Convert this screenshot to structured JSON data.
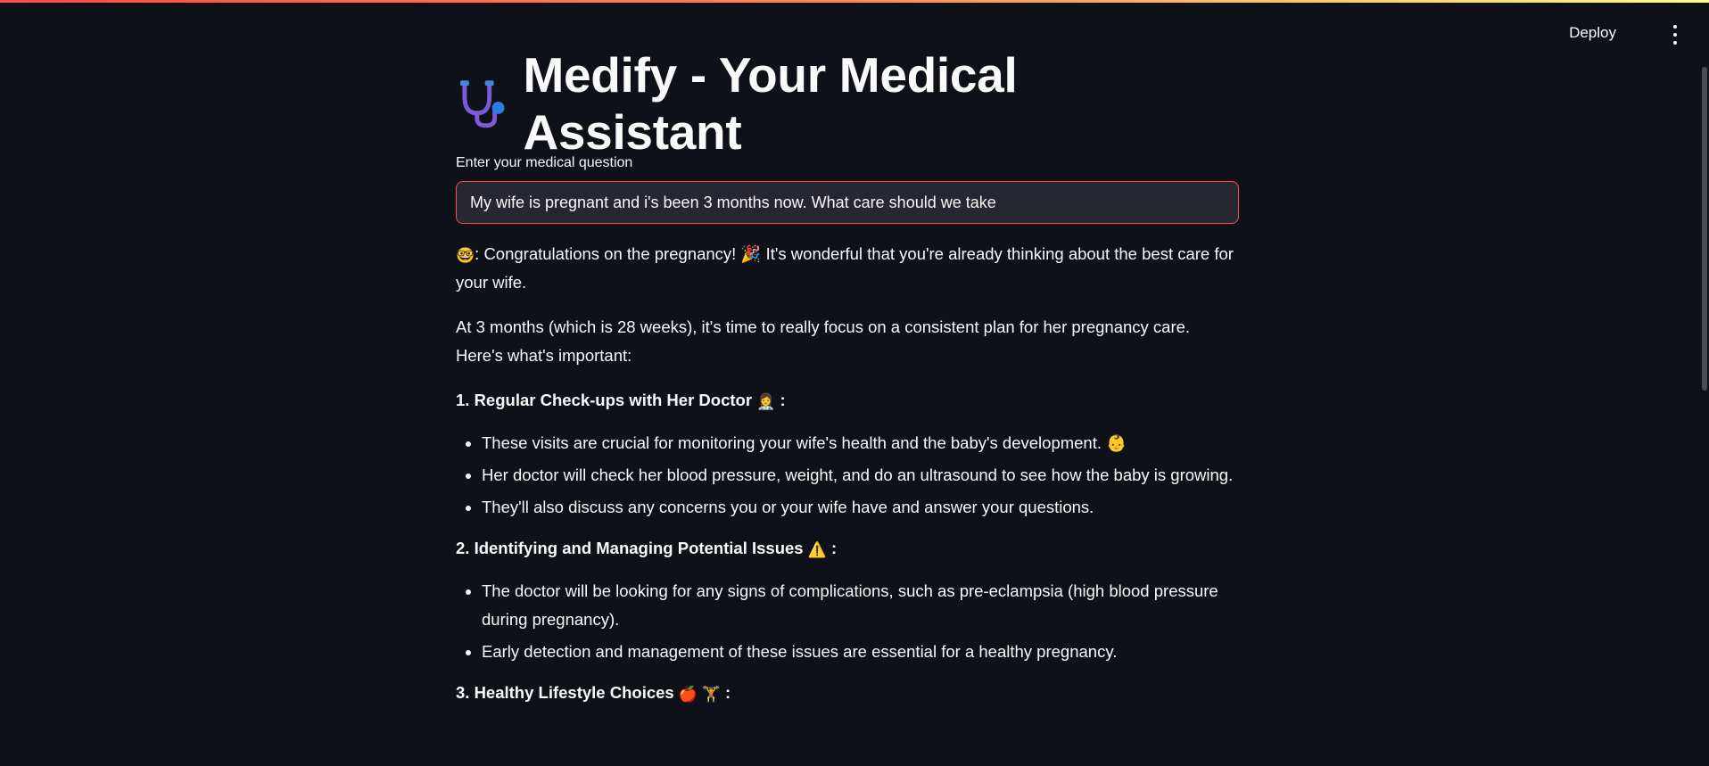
{
  "header": {
    "deploy_label": "Deploy",
    "menu_icon": "kebab-menu-icon"
  },
  "page": {
    "title": "Medify - Your Medical Assistant",
    "title_icon": "stethoscope-icon"
  },
  "question": {
    "label": "Enter your medical question",
    "value": "My wife is pregnant and i's been 3 months now. What care should we take"
  },
  "answer": {
    "intro_icon": "🤓",
    "intro_text": ": Congratulations on the pregnancy! 🎉  It's wonderful that you're already thinking about the best care for your wife.",
    "para2": "At 3 months (which is 28 weeks), it's time to really focus on a consistent plan for her pregnancy care. Here's what's important:",
    "sections": [
      {
        "heading": "1. Regular Check-ups with Her Doctor",
        "heading_emoji": "👩‍⚕️",
        "bullets": [
          "These visits are crucial for monitoring your wife's health and the baby's development. 👶",
          "Her doctor will check her blood pressure, weight, and do an ultrasound to see how the baby is growing.",
          "They'll also discuss any concerns you or your wife have and answer your questions."
        ]
      },
      {
        "heading": "2. Identifying and Managing Potential Issues",
        "heading_emoji": "⚠️",
        "bullets": [
          "The doctor will be looking for any signs of complications, such as pre-eclampsia (high blood pressure during pregnancy).",
          "Early detection and management of these issues are essential for a healthy pregnancy."
        ]
      },
      {
        "heading": "3. Healthy Lifestyle Choices",
        "heading_emoji": "🍎 🏋️",
        "bullets": []
      }
    ],
    "colon": ":"
  },
  "colors": {
    "background": "#0e1117",
    "input_border": "#ff4b4b",
    "input_bg": "#262730",
    "text": "#fafafa"
  }
}
